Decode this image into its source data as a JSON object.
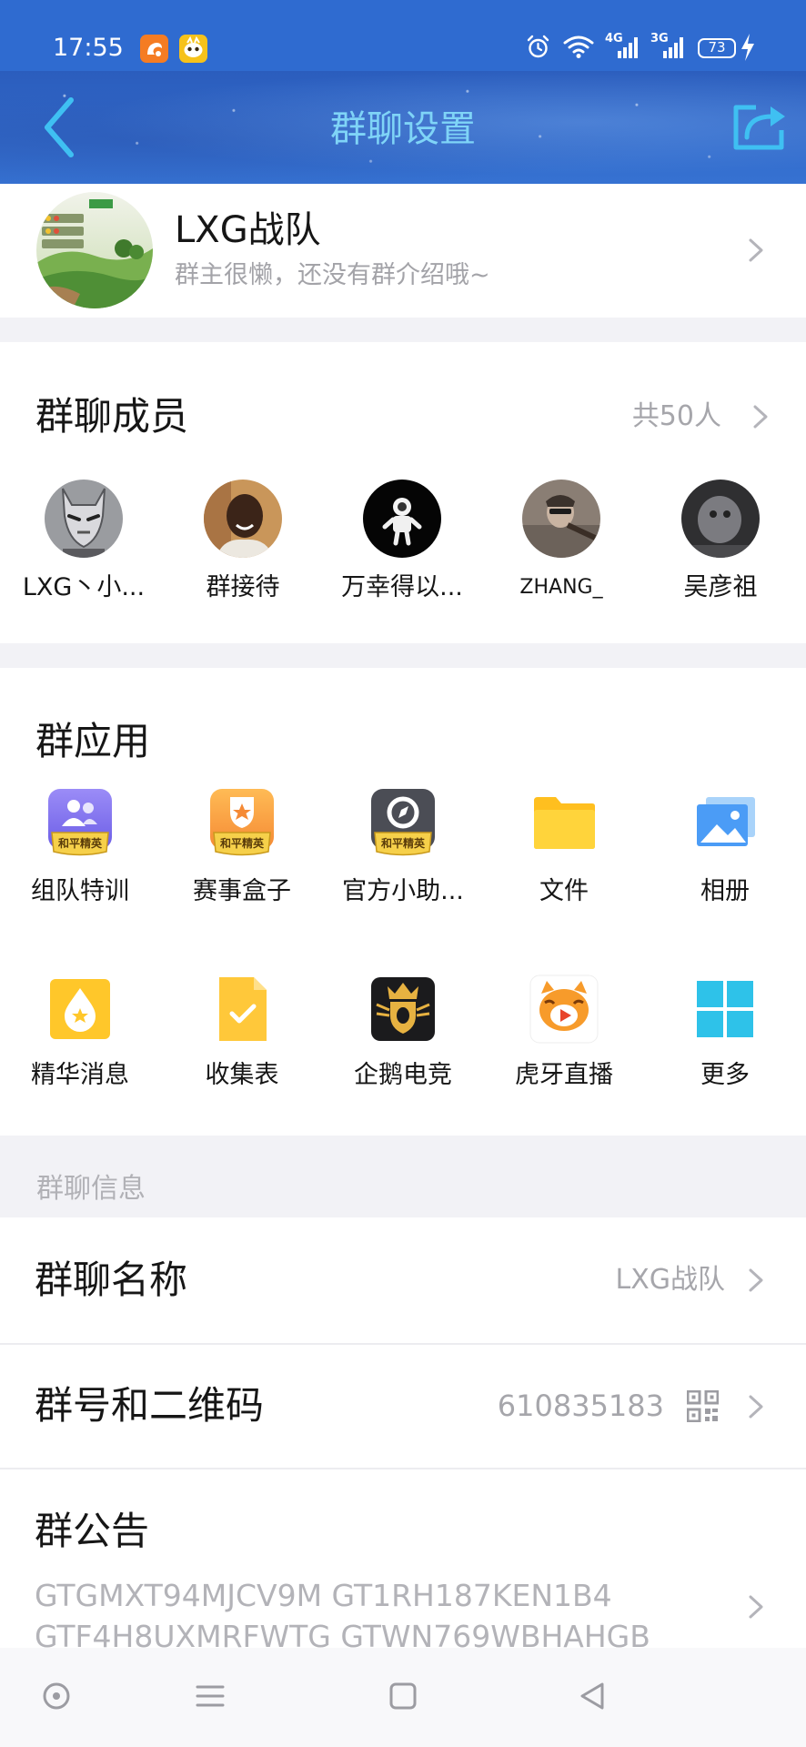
{
  "status_bar": {
    "time": "17:55",
    "net1": "4G",
    "net2": "3G",
    "battery": "73",
    "icons": [
      "uc-browser-icon",
      "game-app-icon",
      "alarm-icon",
      "wifi-icon",
      "signal-icon",
      "battery-icon",
      "charging-icon"
    ]
  },
  "header": {
    "title": "群聊设置",
    "back_icon": "back-chevron-icon",
    "share_icon": "share-icon"
  },
  "group": {
    "name": "LXG战队",
    "intro": "群主很懒，还没有群介绍哦~"
  },
  "members": {
    "title": "群聊成员",
    "count": "共50人",
    "list": [
      {
        "name": "LXG丶小..."
      },
      {
        "name": "群接待"
      },
      {
        "name": "万幸得以..."
      },
      {
        "name": "ZHANG_"
      },
      {
        "name": "吴彦祖"
      }
    ]
  },
  "apps": {
    "title": "群应用",
    "badge_text": "和平精英",
    "items": [
      {
        "label": "组队特训",
        "icon": "team-training-icon"
      },
      {
        "label": "赛事盒子",
        "icon": "event-box-icon"
      },
      {
        "label": "官方小助...",
        "icon": "official-assistant-icon"
      },
      {
        "label": "文件",
        "icon": "folder-icon"
      },
      {
        "label": "相册",
        "icon": "album-icon"
      },
      {
        "label": "精华消息",
        "icon": "essence-icon"
      },
      {
        "label": "收集表",
        "icon": "collection-form-icon"
      },
      {
        "label": "企鹅电竞",
        "icon": "penguin-esports-icon"
      },
      {
        "label": "虎牙直播",
        "icon": "huya-live-icon"
      },
      {
        "label": "更多",
        "icon": "more-grid-icon"
      }
    ]
  },
  "info": {
    "section_title": "群聊信息",
    "name_label": "群聊名称",
    "name_value": "LXG战队",
    "id_label": "群号和二维码",
    "id_value": "610835183",
    "notice_label": "群公告",
    "notice_lines": [
      "GTGMXT94MJCV9M GT1RH187KEN1B4",
      "GTF4H8UXMRFWTG GTWN769WBHAHGB"
    ]
  },
  "nav": {
    "icons": [
      "home-circle-icon",
      "menu-icon",
      "square-icon",
      "back-triangle-icon"
    ]
  },
  "colors": {
    "status_bar": "#2f6bd0",
    "header_title": "#7fd4f7",
    "header_icon": "#3fc0f2",
    "text_primary": "#161616",
    "text_secondary": "#a6a6ab",
    "section_gap": "#f2f2f6"
  }
}
